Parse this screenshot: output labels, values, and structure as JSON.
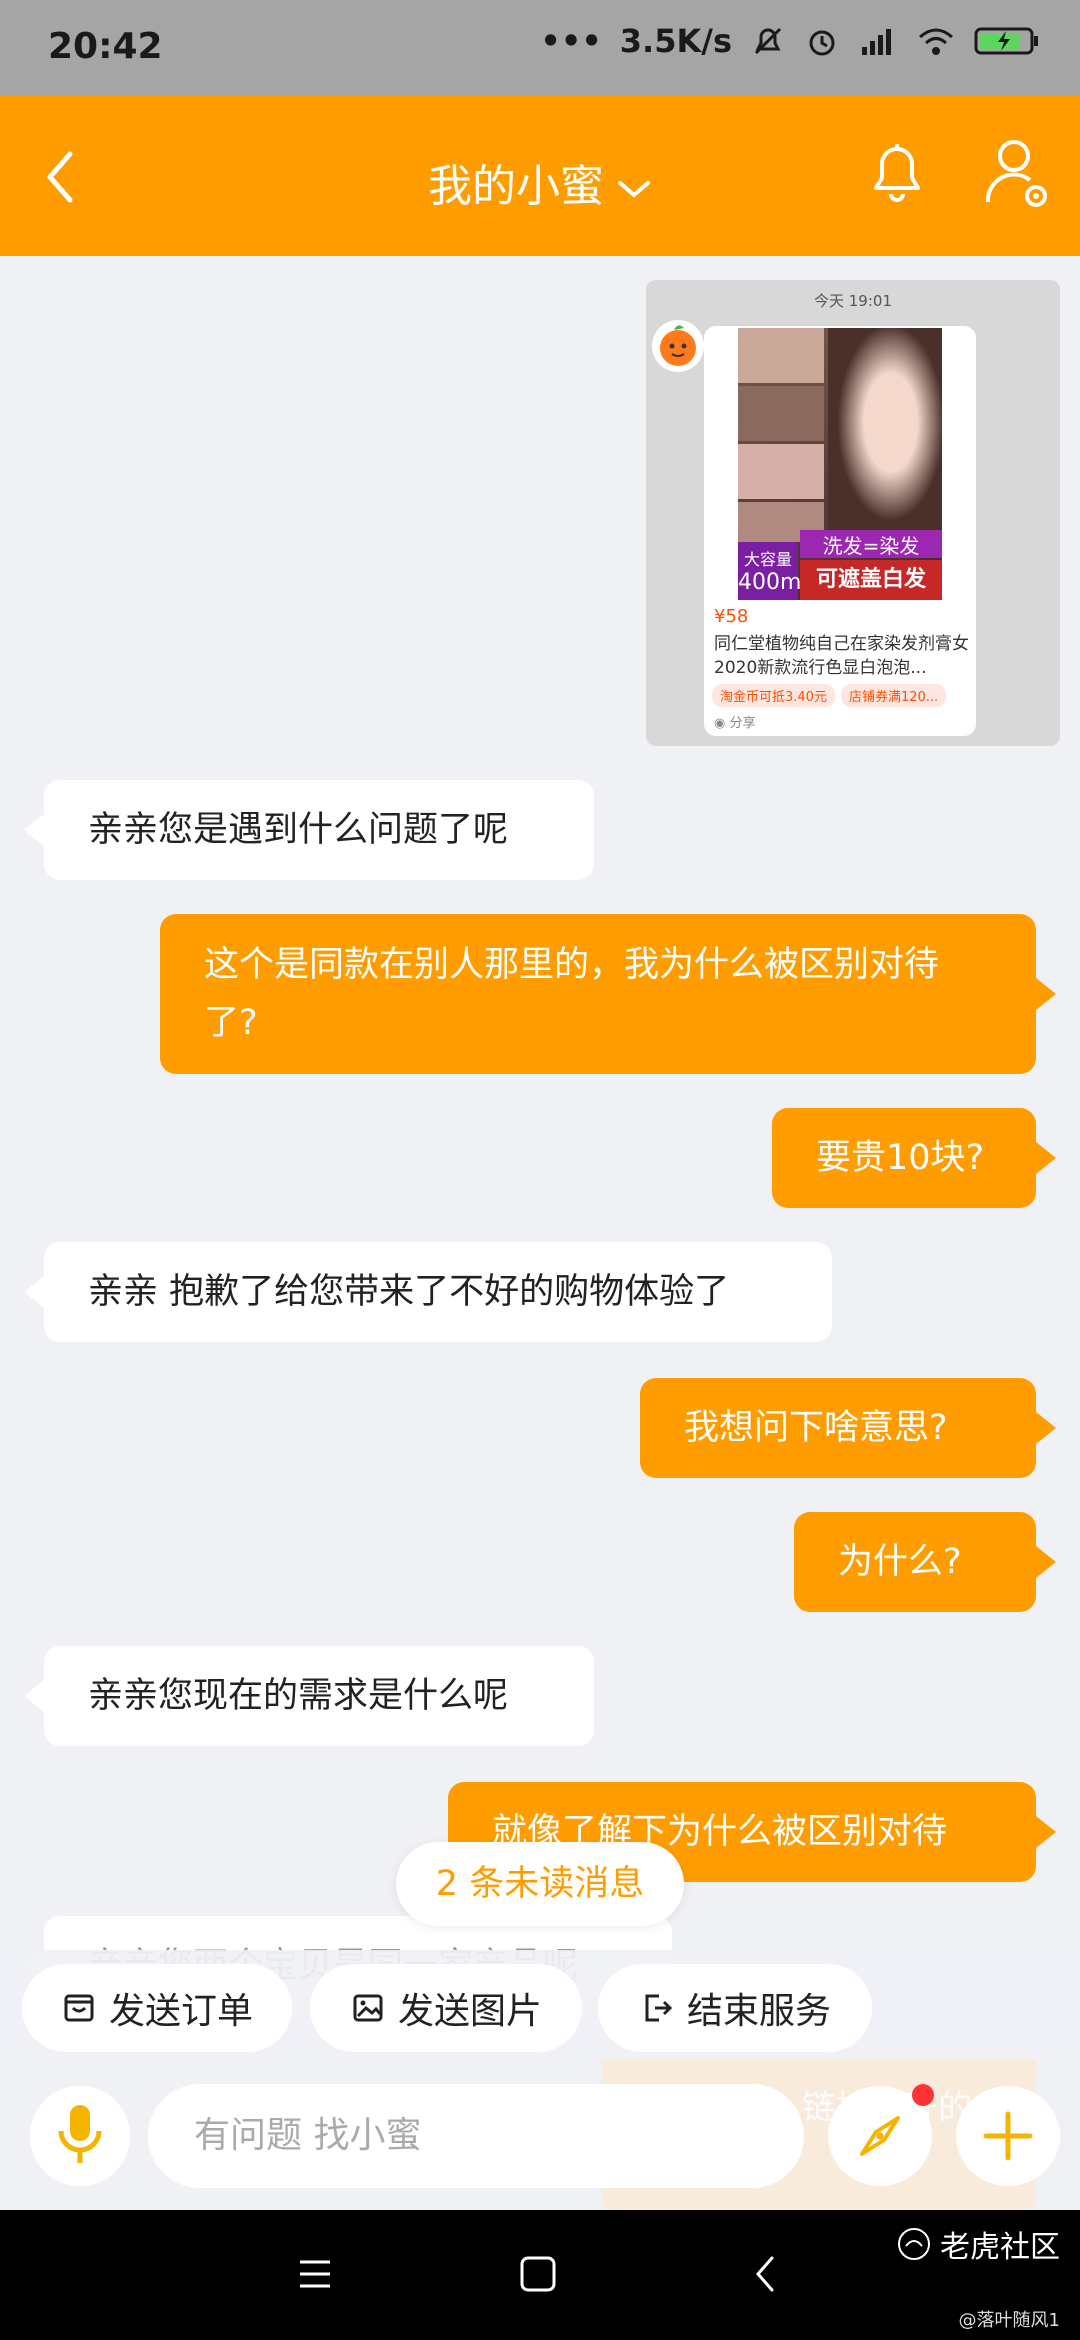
{
  "status_bar": {
    "time": "20:42",
    "network_speed": "3.5K/s",
    "icons": [
      "dots-icon",
      "mute-icon",
      "alarm-icon",
      "hd-signal-icon",
      "wifi-icon",
      "battery-charging-icon"
    ]
  },
  "header": {
    "title": "我的小蜜",
    "back_icon": "chevron-left-icon",
    "dropdown_icon": "chevron-down-icon",
    "bell_icon": "bell-icon",
    "settings_icon": "user-gear-icon"
  },
  "shared_card": {
    "time": "今天 19:01",
    "badge_capacity": "大容量",
    "badge_capacity_num": "400ml",
    "badge_wash": "洗发=染发",
    "badge_cover": "可遮盖白发",
    "price": "¥58",
    "desc": "同仁堂植物纯自己在家染发剂膏女2020新款流行色显白泡泡...",
    "tag_coins": "淘金币可抵3.40元",
    "tag_coupon": "店铺券满120...",
    "share": "分享"
  },
  "messages": [
    {
      "side": "left",
      "text": "亲亲您是遇到什么问题了呢"
    },
    {
      "side": "right",
      "text": "这个是同款在别人那里的，我为什么被区别对待了?"
    },
    {
      "side": "right",
      "text": "要贵10块?"
    },
    {
      "side": "left",
      "text": "亲亲 抱歉了给您带来了不好的购物体验了"
    },
    {
      "side": "right",
      "text": "我想问下啥意思?"
    },
    {
      "side": "right",
      "text": "为什么?"
    },
    {
      "side": "left",
      "text": "亲亲您现在的需求是什么呢"
    },
    {
      "side": "right",
      "text": "就像了解下为什么被区别对待"
    },
    {
      "side": "left",
      "text": "亲亲您两个宝贝是同一家产品呢"
    }
  ],
  "unread_pill": "2 条未读消息",
  "quick_actions": {
    "send_order": "发送订单",
    "send_image": "发送图片",
    "end_service": "结束服务"
  },
  "faded_card_text": "链接打开的",
  "input": {
    "placeholder": "有问题 找小蜜"
  },
  "watermark": {
    "brand": "老虎社区",
    "user": "@落叶随风1"
  },
  "colors": {
    "accent": "#ff9d00",
    "background": "#f0f1f5"
  }
}
